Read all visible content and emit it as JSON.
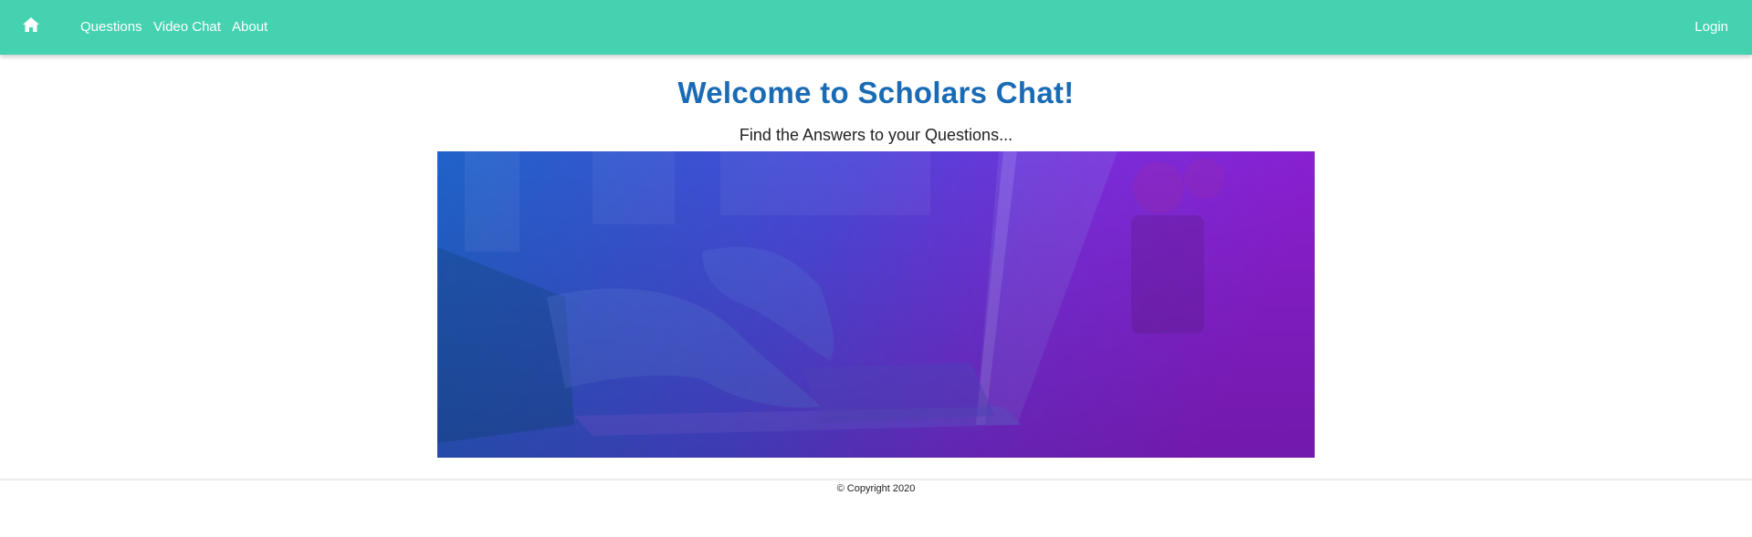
{
  "nav": {
    "home_icon": "home-icon",
    "links": {
      "questions": "Questions",
      "video_chat": "Video Chat",
      "about": "About"
    },
    "login": "Login"
  },
  "main": {
    "title": "Welcome to Scholars Chat!",
    "subtitle": "Find the Answers to your Questions..."
  },
  "footer": {
    "copyright": "© Copyright 2020"
  },
  "colors": {
    "navbar": "#45d2b0",
    "title": "#1a6bb5",
    "hero_gradient_start": "#1f63c8",
    "hero_gradient_end": "#8a1fd0"
  }
}
